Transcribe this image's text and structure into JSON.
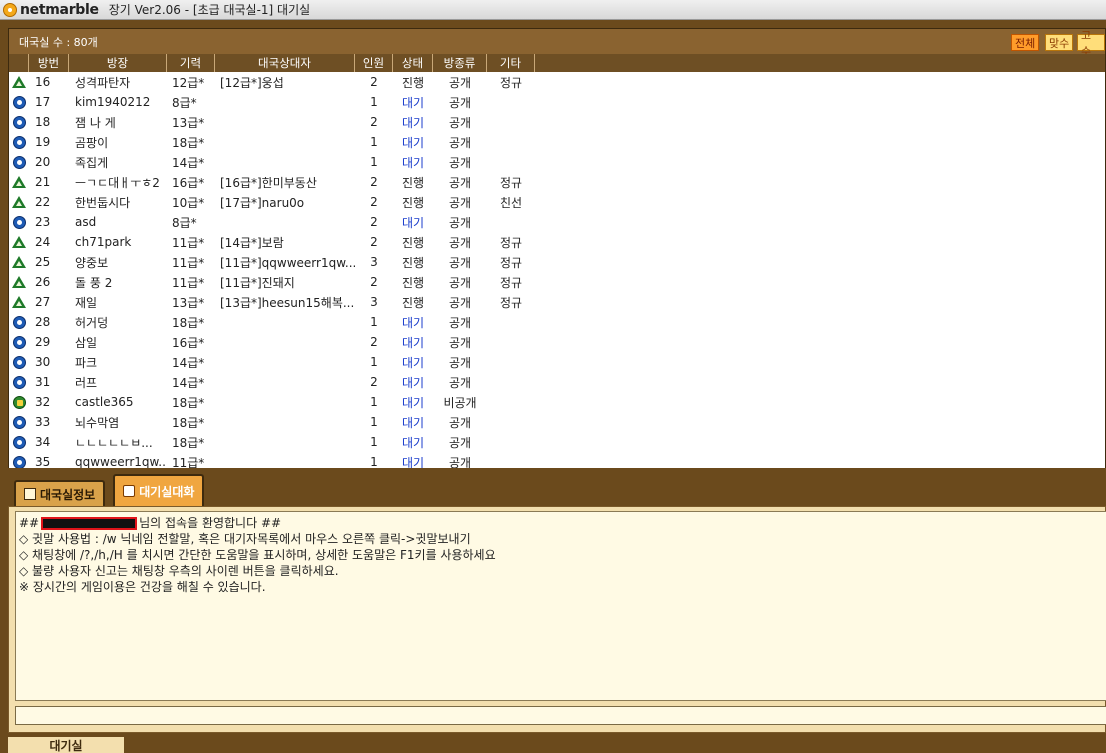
{
  "titlebar": {
    "logo_text": "netmarble",
    "title": "장기 Ver2.06 - [초급 대국실-1] 대기실"
  },
  "room_list": {
    "count_label": "대국실 수 : 80개",
    "filters": [
      "전체",
      "맞수",
      "고수"
    ],
    "columns": [
      "방번",
      "방장",
      "기력",
      "대국상대자",
      "인원",
      "상태",
      "방종류",
      "기타"
    ],
    "rows": [
      {
        "icon": "playing-icon",
        "num": "16",
        "host": "성격파탄자",
        "rank": "12급*",
        "opponent": "[12급*]웅섭",
        "count": "2",
        "status": "진행",
        "type": "공개",
        "etc": "정규"
      },
      {
        "icon": "waiting-icon",
        "num": "17",
        "host": "kim1940212",
        "rank": "8급*",
        "opponent": "",
        "count": "1",
        "status": "대기",
        "type": "공개",
        "etc": ""
      },
      {
        "icon": "waiting-icon",
        "num": "18",
        "host": "잼 나 게",
        "rank": "13급*",
        "opponent": "",
        "count": "2",
        "status": "대기",
        "type": "공개",
        "etc": ""
      },
      {
        "icon": "waiting-icon",
        "num": "19",
        "host": "곰팡이",
        "rank": "18급*",
        "opponent": "",
        "count": "1",
        "status": "대기",
        "type": "공개",
        "etc": ""
      },
      {
        "icon": "waiting-icon",
        "num": "20",
        "host": "족집게",
        "rank": "14급*",
        "opponent": "",
        "count": "1",
        "status": "대기",
        "type": "공개",
        "etc": ""
      },
      {
        "icon": "playing-icon",
        "num": "21",
        "host": "ㅡㄱㄷ대ㅐㅜㅎ2",
        "rank": "16급*",
        "opponent": "[16급*]한미부동산",
        "count": "2",
        "status": "진행",
        "type": "공개",
        "etc": "정규"
      },
      {
        "icon": "playing-icon",
        "num": "22",
        "host": "한번둡시다",
        "rank": "10급*",
        "opponent": "[17급*]naru0o",
        "count": "2",
        "status": "진행",
        "type": "공개",
        "etc": "친선"
      },
      {
        "icon": "waiting-icon",
        "num": "23",
        "host": "asd",
        "rank": "8급*",
        "opponent": "",
        "count": "2",
        "status": "대기",
        "type": "공개",
        "etc": ""
      },
      {
        "icon": "playing-icon",
        "num": "24",
        "host": "ch71park",
        "rank": "11급*",
        "opponent": "[14급*]보람",
        "count": "2",
        "status": "진행",
        "type": "공개",
        "etc": "정규"
      },
      {
        "icon": "playing-icon",
        "num": "25",
        "host": "양중보",
        "rank": "11급*",
        "opponent": "[11급*]qqwweerr1qw...",
        "count": "3",
        "status": "진행",
        "type": "공개",
        "etc": "정규"
      },
      {
        "icon": "playing-icon",
        "num": "26",
        "host": "돌 풍 2",
        "rank": "11급*",
        "opponent": "[11급*]진돼지",
        "count": "2",
        "status": "진행",
        "type": "공개",
        "etc": "정규"
      },
      {
        "icon": "playing-icon",
        "num": "27",
        "host": "재일",
        "rank": "13급*",
        "opponent": "[13급*]heesun15해복...",
        "count": "3",
        "status": "진행",
        "type": "공개",
        "etc": "정규"
      },
      {
        "icon": "waiting-icon",
        "num": "28",
        "host": "허거덩",
        "rank": "18급*",
        "opponent": "",
        "count": "1",
        "status": "대기",
        "type": "공개",
        "etc": ""
      },
      {
        "icon": "waiting-icon",
        "num": "29",
        "host": "삼일",
        "rank": "16급*",
        "opponent": "",
        "count": "2",
        "status": "대기",
        "type": "공개",
        "etc": ""
      },
      {
        "icon": "waiting-icon",
        "num": "30",
        "host": "파크",
        "rank": "14급*",
        "opponent": "",
        "count": "1",
        "status": "대기",
        "type": "공개",
        "etc": ""
      },
      {
        "icon": "waiting-icon",
        "num": "31",
        "host": "러프",
        "rank": "14급*",
        "opponent": "",
        "count": "2",
        "status": "대기",
        "type": "공개",
        "etc": ""
      },
      {
        "icon": "private-icon",
        "num": "32",
        "host": "castle365",
        "rank": "18급*",
        "opponent": "",
        "count": "1",
        "status": "대기",
        "type": "비공개",
        "etc": ""
      },
      {
        "icon": "waiting-icon",
        "num": "33",
        "host": "뇌수막염",
        "rank": "18급*",
        "opponent": "",
        "count": "1",
        "status": "대기",
        "type": "공개",
        "etc": ""
      },
      {
        "icon": "waiting-icon",
        "num": "34",
        "host": "ㄴㄴㄴㄴㄴㅂ...",
        "rank": "18급*",
        "opponent": "",
        "count": "1",
        "status": "대기",
        "type": "공개",
        "etc": ""
      },
      {
        "icon": "waiting-icon",
        "num": "35",
        "host": "qqwweerr1qw...",
        "rank": "11급*",
        "opponent": "",
        "count": "1",
        "status": "대기",
        "type": "공개",
        "etc": ""
      }
    ]
  },
  "tabs": [
    {
      "label": "대국실정보",
      "icon": "info-icon",
      "active": false
    },
    {
      "label": "대기실대화",
      "icon": "chat-icon",
      "active": true
    }
  ],
  "chat": {
    "welcome_prefix": "##",
    "welcome_suffix": "님의 접속을 환영합니다 ##",
    "lines": [
      "◇ 귓말 사용법 : /w 닉네임 전할말, 혹은 대기자목록에서 마우스 오른쪽 클릭->귓말보내기",
      "◇ 채팅창에 /?,/h,/H 를 치시면 간단한 도움말을 표시하며, 상세한 도움말은 F1키를 사용하세요",
      "◇ 불량 사용자 신고는 채팅창 우측의 사이렌 버튼을 클릭하세요.",
      "※ 장시간의 게임이용은 건강을 해칠 수 있습니다."
    ],
    "input_value": ""
  },
  "bottom": {
    "tab_label": "대기실"
  }
}
